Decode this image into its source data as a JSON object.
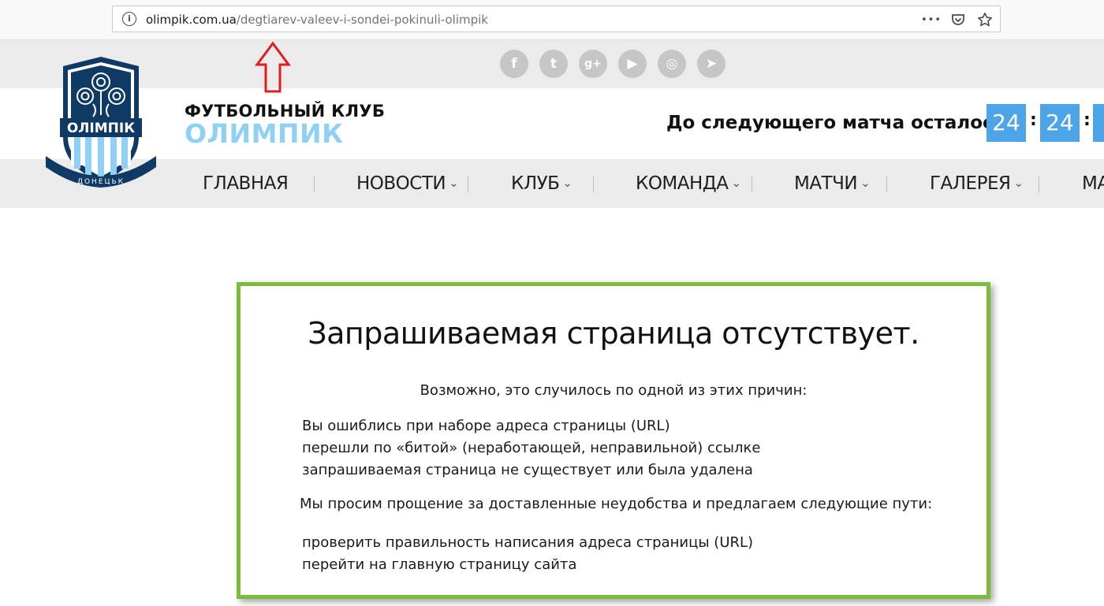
{
  "browser": {
    "url_domain": "olimpik.com.ua",
    "url_path": "/degtiarev-valeev-i-sondei-pokinuli-olimpik",
    "info_glyph": "i",
    "more_glyph": "•••",
    "icons": [
      "info-icon",
      "more-icon",
      "pocket-icon",
      "bookmark-star-icon"
    ]
  },
  "social": [
    {
      "name": "facebook-icon",
      "glyph": "f"
    },
    {
      "name": "twitter-icon",
      "glyph": "t"
    },
    {
      "name": "google-plus-icon",
      "glyph": "g+"
    },
    {
      "name": "youtube-icon",
      "glyph": "▶"
    },
    {
      "name": "instagram-icon",
      "glyph": "◎"
    },
    {
      "name": "telegram-icon",
      "glyph": "➤"
    }
  ],
  "logo": {
    "text": "ОЛІМПІК",
    "ribbon": "ДОНЕЦЬК"
  },
  "brand": {
    "line1": "ФУТБОЛЬНЫЙ КЛУБ",
    "line2": "ОЛИМПИК"
  },
  "countdown": {
    "label": "До следующего матча осталось",
    "values": [
      "24",
      "24"
    ],
    "separator": ":"
  },
  "nav": {
    "items": [
      {
        "label": "ГЛАВНАЯ",
        "has_menu": false
      },
      {
        "label": "НОВОСТИ",
        "has_menu": true
      },
      {
        "label": "КЛУБ",
        "has_menu": true
      },
      {
        "label": "КОМАНДА",
        "has_menu": true
      },
      {
        "label": "МАТЧИ",
        "has_menu": true
      },
      {
        "label": "ГАЛЕРЕЯ",
        "has_menu": true
      },
      {
        "label": "МА",
        "has_menu": false
      }
    ],
    "chevron": "⌄"
  },
  "error": {
    "title": "Запрашиваемая страница отсутствует.",
    "subtitle": "Возможно, это случилось по одной из этих причин:",
    "reasons": [
      "Вы ошиблись при наборе адреса страницы (URL)",
      "перешли по «битой» (неработающей, неправильной) ссылке",
      "запрашиваемая страница не существует или была удалена"
    ],
    "apology": "Мы просим прощение за доставленные неудобства и предлагаем следующие пути:",
    "options": [
      "проверить правильность написания адреса страницы (URL)",
      "перейти на главную страницу сайта"
    ]
  },
  "colors": {
    "accent_blue": "#4da5e8",
    "brand_light_blue": "#8fd0f4",
    "logo_navy": "#0f3a63",
    "error_border_green": "#7dbb3b",
    "annotation_red": "#e21b1b"
  }
}
